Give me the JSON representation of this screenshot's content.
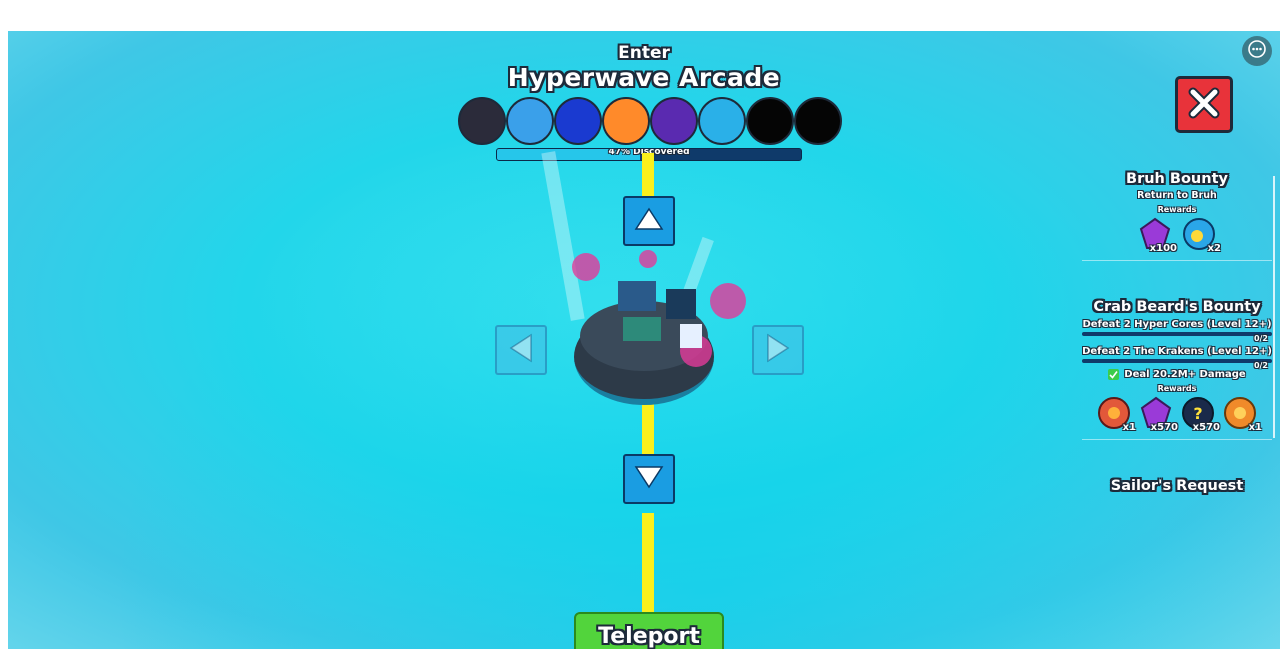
{
  "top_left": {
    "roblox_icon": "roblox-logo-icon",
    "chat_icon": "chat-notes-icon"
  },
  "top_right": {
    "menu_icon": "more-options-icon"
  },
  "zone": {
    "enter_label": "Enter",
    "name": "Hyperwave Arcade",
    "discovered_label": "47% Discovered",
    "discovered_percent": 47,
    "pets": [
      {
        "name": "panda-pet-icon",
        "color": "#2b2b3a"
      },
      {
        "name": "blue-blob-pet-icon",
        "color": "#3aa0ea"
      },
      {
        "name": "blue-ghost-pet-icon",
        "color": "#1a3ad0"
      },
      {
        "name": "orange-cat-pet-icon",
        "color": "#ff8a2a"
      },
      {
        "name": "purple-dragon-pet-icon",
        "color": "#5a2ab0"
      },
      {
        "name": "rainbow-orb-pet-icon",
        "color": "#2ab0e8"
      },
      {
        "name": "locked-pet-silhouette-icon",
        "color": "#050505"
      },
      {
        "name": "locked-pet-silhouette-icon",
        "color": "#050505"
      }
    ]
  },
  "navigation": {
    "up_icon": "arrow-up-icon",
    "down_icon": "arrow-down-icon",
    "left_icon": "arrow-left-icon",
    "right_icon": "arrow-right-icon"
  },
  "teleport_label": "Teleport",
  "close_icon": "close-x-icon",
  "quests": [
    {
      "title": "Bruh Bounty",
      "subtitle": "Return to Bruh",
      "rewards_label": "Rewards",
      "rewards": [
        {
          "icon": "purple-gem-icon",
          "amount": "x100"
        },
        {
          "icon": "lightbulb-potion-icon",
          "amount": "x2"
        }
      ]
    },
    {
      "title": "Crab Beard's Bounty",
      "tasks": [
        {
          "text": "Defeat 2 Hyper Cores (Level 12+)",
          "count": "0/2",
          "progress": 0
        },
        {
          "text": "Defeat 2 The Krakens (Level 12+)",
          "count": "0/2",
          "progress": 0
        }
      ],
      "completed_task": "Deal 20.2M+ Damage",
      "rewards_label": "Rewards",
      "rewards": [
        {
          "icon": "red-flower-icon",
          "amount": "x1"
        },
        {
          "icon": "purple-gem-icon",
          "amount": "x570"
        },
        {
          "icon": "mystery-orb-icon",
          "amount": "x570"
        },
        {
          "icon": "orange-flower-icon",
          "amount": "x1"
        }
      ]
    },
    {
      "title": "Sailor's Request"
    }
  ]
}
